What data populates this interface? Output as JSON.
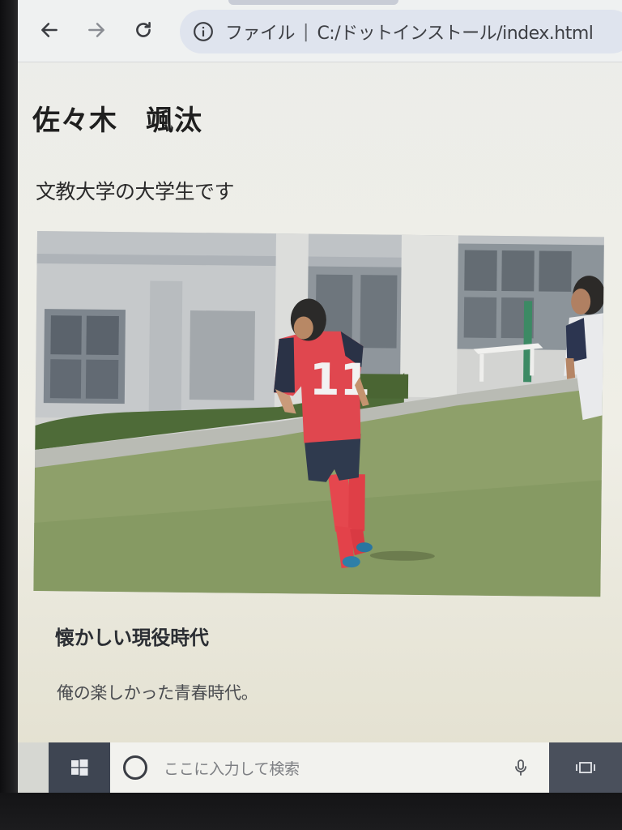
{
  "browser": {
    "back_icon": "arrow-left-icon",
    "forward_icon": "arrow-right-icon",
    "reload_icon": "reload-icon",
    "security_icon": "info-circle-icon",
    "security_label": "ファイル",
    "separator": "|",
    "url": "C:/ドットインストール/index.html"
  },
  "page": {
    "heading": "佐々木　颯汰",
    "intro": "文教大学の大学生です",
    "photo_subject": "soccer-player-photo",
    "section_heading": "懐かしい現役時代",
    "section_text": "俺の楽しかった青春時代。"
  },
  "taskbar": {
    "start_icon": "windows-logo-icon",
    "search_placeholder": "ここに入力して検索",
    "mic_icon": "microphone-icon",
    "taskview_icon": "task-view-icon"
  },
  "colors": {
    "omnibox_bg": "#dfe4ee",
    "jersey_red": "#e0474f",
    "grass": "#8ea06a"
  }
}
